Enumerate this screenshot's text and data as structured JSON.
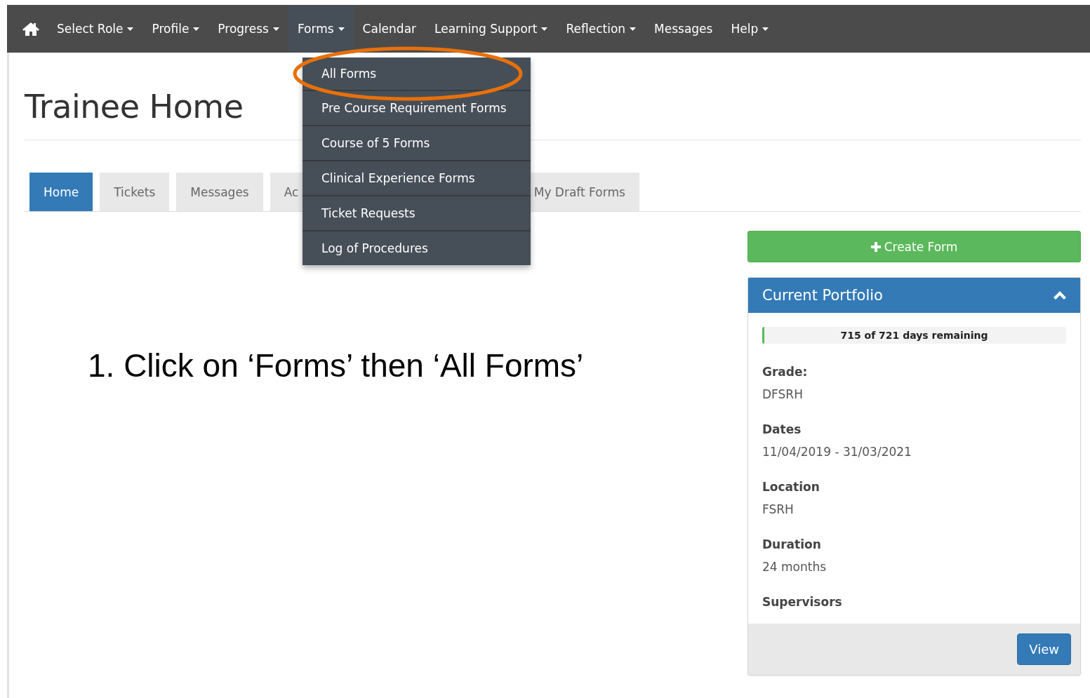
{
  "navbar": {
    "items": [
      {
        "label": "Select Role",
        "dropdown": true,
        "selected": false
      },
      {
        "label": "Profile",
        "dropdown": true,
        "selected": false
      },
      {
        "label": "Progress",
        "dropdown": true,
        "selected": false
      },
      {
        "label": "Forms",
        "dropdown": true,
        "selected": true
      },
      {
        "label": "Calendar",
        "dropdown": false,
        "selected": false
      },
      {
        "label": "Learning Support",
        "dropdown": true,
        "selected": false
      },
      {
        "label": "Reflection",
        "dropdown": true,
        "selected": false
      },
      {
        "label": "Messages",
        "dropdown": false,
        "selected": false
      },
      {
        "label": "Help",
        "dropdown": true,
        "selected": false
      }
    ]
  },
  "dropdown_menu": {
    "items": [
      {
        "label": "All Forms",
        "highlighted": true
      },
      {
        "label": "Pre Course Requirement Forms",
        "highlighted": false
      },
      {
        "label": "Course of 5 Forms",
        "highlighted": false
      },
      {
        "label": "Clinical Experience Forms",
        "highlighted": false
      },
      {
        "label": "Ticket Requests",
        "highlighted": false
      },
      {
        "label": "Log of Procedures",
        "highlighted": false
      }
    ]
  },
  "page_title": "Trainee Home",
  "tabs": [
    {
      "label": "Home",
      "selected": true
    },
    {
      "label": "Tickets",
      "selected": false
    },
    {
      "label": "Messages",
      "selected": false
    },
    {
      "label": "Ac",
      "selected": false
    },
    {
      "label": "My Draft Forms",
      "selected": false
    }
  ],
  "instruction": "1. Click on ‘Forms’ then ‘All Forms’",
  "create_button": "Create Form",
  "portfolio": {
    "title": "Current Portfolio",
    "expanded": true,
    "progress": {
      "level": 0.006,
      "reading": "715 of 721 days remaining"
    },
    "fields": [
      {
        "label": "Grade:",
        "value": "DFSRH"
      },
      {
        "label": "Dates",
        "value": "11/04/2019 - 31/03/2021"
      },
      {
        "label": "Location",
        "value": "FSRH"
      },
      {
        "label": "Duration",
        "value": "24 months"
      },
      {
        "label": "Supervisors"
      }
    ],
    "view_button": "View"
  }
}
